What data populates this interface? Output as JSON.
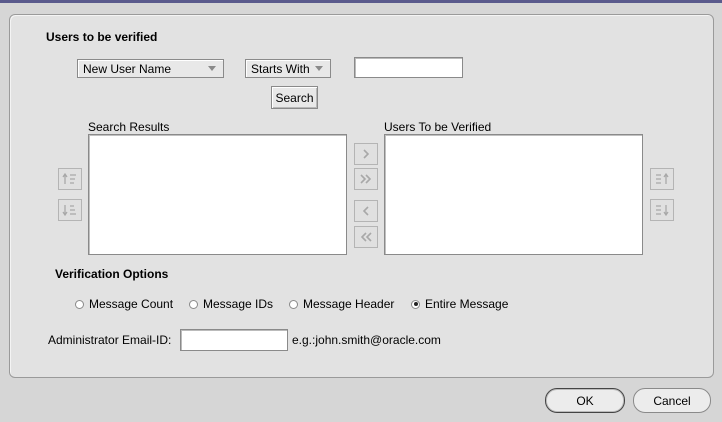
{
  "section_users": {
    "title": "Users to be verified"
  },
  "filter": {
    "field_select": "New User Name",
    "operator_select": "Starts With",
    "value": "",
    "search_button": "Search"
  },
  "lists": {
    "search_results_label": "Search Results",
    "to_verify_label": "Users To be Verified"
  },
  "icons": {
    "sort_ascending_left": "sort-ascending-icon",
    "sort_descending_left": "sort-descending-icon",
    "move_right": "move-right-icon",
    "move_all_right": "move-all-right-icon",
    "move_left": "move-left-icon",
    "move_all_left": "move-all-left-icon",
    "move_up_right": "move-up-icon",
    "move_down_right": "move-down-icon"
  },
  "verification": {
    "title": "Verification Options",
    "options": [
      "Message Count",
      "Message IDs",
      "Message Header",
      "Entire Message"
    ],
    "selected": "Entire Message"
  },
  "admin": {
    "label": "Administrator Email-ID:",
    "value": "",
    "example": "e.g.:john.smith@oracle.com"
  },
  "footer": {
    "ok_label": "OK",
    "cancel_label": "Cancel"
  }
}
